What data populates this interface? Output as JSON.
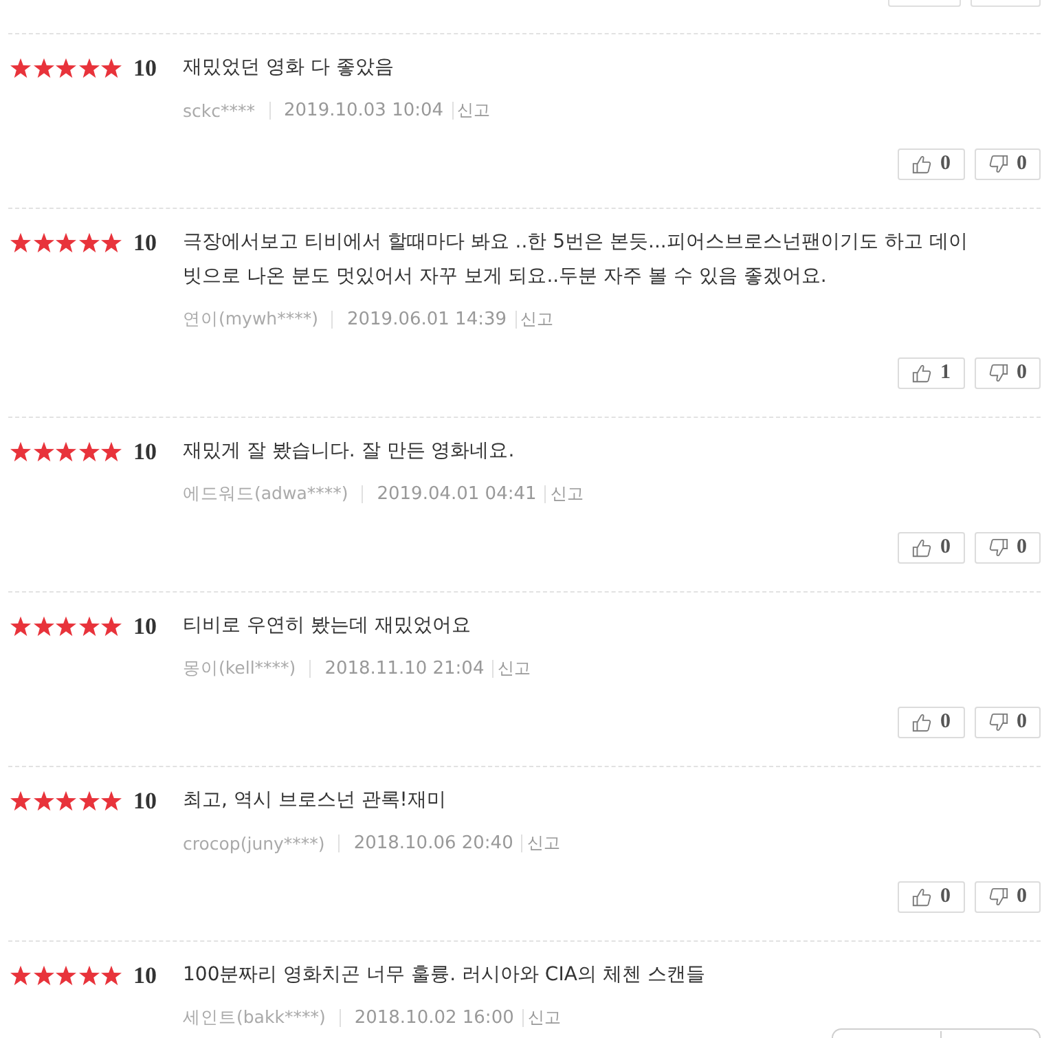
{
  "reviews": [
    {
      "stars": 5,
      "score": "10",
      "comment": "재밌었던 영화 다 좋았음",
      "nickname": "sckc****",
      "date": "2019.10.03 10:04",
      "report": "신고",
      "likes": "0",
      "dislikes": "0"
    },
    {
      "stars": 5,
      "score": "10",
      "comment": "극장에서보고 티비에서 할때마다 봐요 ..한 5번은 본듯...피어스브로스넌팬이기도 하고 데이빗으로 나온 분도 멋있어서 자꾸 보게 되요..두분 자주 볼 수 있음 좋겠어요.",
      "nickname": "연이(mywh****)",
      "date": "2019.06.01 14:39",
      "report": "신고",
      "likes": "1",
      "dislikes": "0"
    },
    {
      "stars": 5,
      "score": "10",
      "comment": "재밌게 잘 봤습니다. 잘 만든 영화네요.",
      "nickname": "에드워드(adwa****)",
      "date": "2019.04.01 04:41",
      "report": "신고",
      "likes": "0",
      "dislikes": "0"
    },
    {
      "stars": 5,
      "score": "10",
      "comment": "티비로 우연히 봤는데 재밌었어요",
      "nickname": "몽이(kell****)",
      "date": "2018.11.10 21:04",
      "report": "신고",
      "likes": "0",
      "dislikes": "0"
    },
    {
      "stars": 5,
      "score": "10",
      "comment": "최고, 역시 브로스넌 관록!재미",
      "nickname": "crocop(juny****)",
      "date": "2018.10.06 20:40",
      "report": "신고",
      "likes": "0",
      "dislikes": "0"
    },
    {
      "stars": 5,
      "score": "10",
      "comment": "100분짜리 영화치곤 너무 훌륭. 러시아와 CIA의 체첸 스캔들",
      "nickname": "세인트(bakk****)",
      "date": "2018.10.02 16:00",
      "report": "신고"
    }
  ]
}
